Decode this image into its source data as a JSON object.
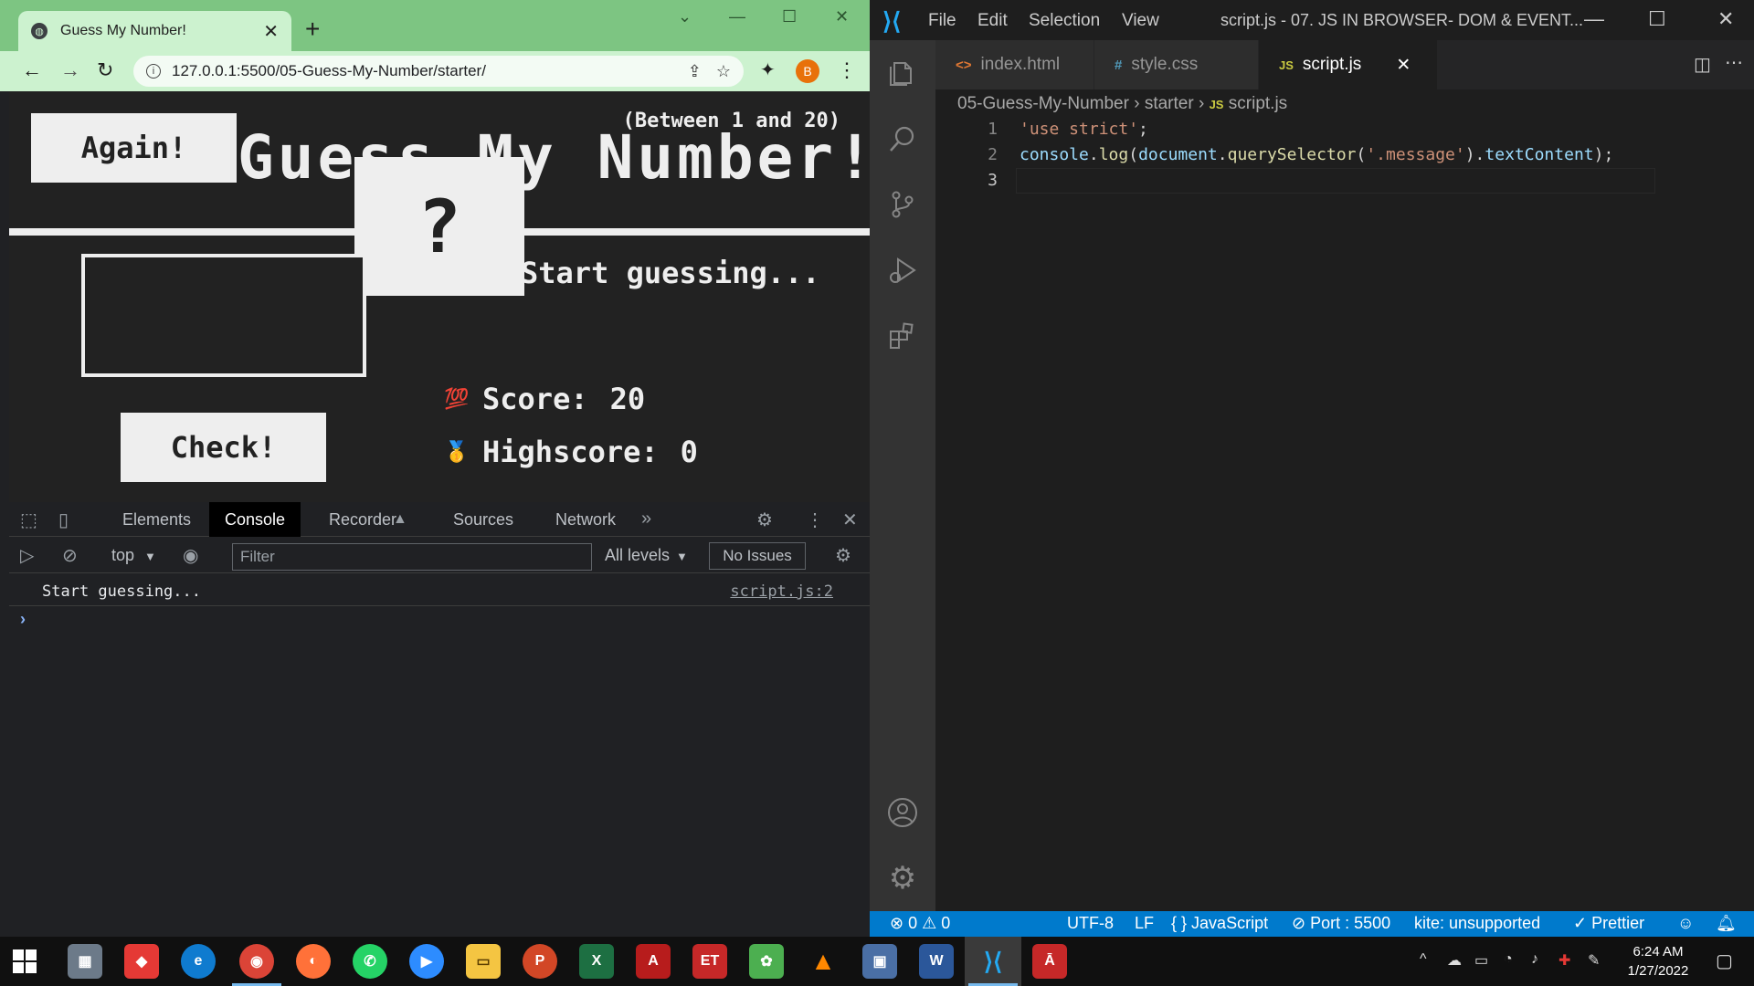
{
  "chrome": {
    "tab_title": "Guess My Number!",
    "tab_close": "✕",
    "new_tab": "+",
    "url": "127.0.0.1:5500/05-Guess-My-Number/starter/",
    "profile_initial": "B"
  },
  "game": {
    "between": "(Between 1 and 20)",
    "title": "Guess My Number!",
    "again_label": "Again!",
    "secret": "?",
    "message": "Start guessing...",
    "check_label": "Check!",
    "score_label": "Score:",
    "score_value": "20",
    "highscore_label": "Highscore:",
    "highscore_value": "0",
    "score_emoji": "💯",
    "highscore_emoji": "🥇"
  },
  "devtools": {
    "tabs": [
      "Elements",
      "Console",
      "Recorder",
      "Sources",
      "Network"
    ],
    "context": "top",
    "filter_placeholder": "Filter",
    "levels": "All levels",
    "issues": "No Issues",
    "console_lines": [
      {
        "text": "Start guessing...",
        "source": "script.js:2"
      }
    ],
    "prompt": "›"
  },
  "vscode": {
    "menu": [
      "File",
      "Edit",
      "Selection",
      "View"
    ],
    "window_title": "script.js - 07. JS IN BROWSER- DOM & EVENT...",
    "tabs": [
      {
        "icon": "<>",
        "label": "index.html"
      },
      {
        "icon": "#",
        "label": "style.css"
      },
      {
        "icon": "JS",
        "label": "script.js"
      }
    ],
    "breadcrumb": [
      "05-Guess-My-Number",
      "starter",
      "script.js"
    ],
    "line_numbers": [
      "1",
      "2",
      "3"
    ],
    "status": {
      "errors": "0",
      "warnings": "0",
      "encoding": "UTF-8",
      "eol": "LF",
      "language": "JavaScript",
      "port": "Port : 5500",
      "kite": "kite: unsupported",
      "prettier": "Prettier"
    }
  },
  "taskbar": {
    "time": "6:24 AM",
    "date": "1/27/2022"
  },
  "colors": {
    "chrome_frame": "#7dc582",
    "chrome_toolbar": "#ccf2cf",
    "page_bg": "#222222",
    "vscode_accent": "#007acc",
    "activitybar": "#333333"
  }
}
